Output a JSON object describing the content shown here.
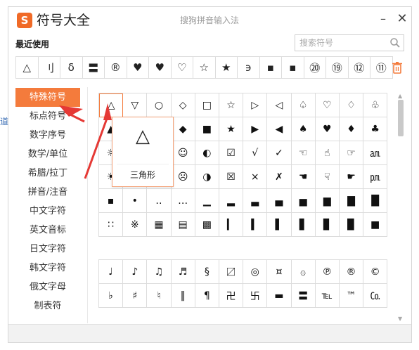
{
  "window": {
    "title": "符号大全",
    "subtitle": "搜狗拼音输入法",
    "logo_letter": "S",
    "minimize_icon": "–",
    "close_icon": "✕",
    "left_hint": "道"
  },
  "recent": {
    "label": "最近使用",
    "symbols": [
      "△",
      "刂",
      "δ",
      "〓",
      "®",
      "♥",
      "♥",
      "♡",
      "☆",
      "★",
      "϶",
      "▪",
      "▪",
      "⑳",
      "⑲",
      "⑫",
      "⑪"
    ]
  },
  "search": {
    "placeholder": "搜索符号",
    "value": ""
  },
  "sidebar": {
    "items": [
      {
        "label": "特殊符号",
        "active": true
      },
      {
        "label": "标点符号",
        "active": false
      },
      {
        "label": "数字序号",
        "active": false
      },
      {
        "label": "数学/单位",
        "active": false
      },
      {
        "label": "希腊/拉丁",
        "active": false
      },
      {
        "label": "拼音/注音",
        "active": false
      },
      {
        "label": "中文字符",
        "active": false
      },
      {
        "label": "英文音标",
        "active": false
      },
      {
        "label": "日文字符",
        "active": false
      },
      {
        "label": "韩文字符",
        "active": false
      },
      {
        "label": "俄文字母",
        "active": false
      },
      {
        "label": "制表符",
        "active": false
      }
    ]
  },
  "grid_top": {
    "symbols": [
      "△",
      "▽",
      "○",
      "◇",
      "□",
      "☆",
      "▷",
      "◁",
      "♤",
      "♡",
      "♢",
      "♧",
      "▲",
      "▼",
      "●",
      "◆",
      "■",
      "★",
      "▶",
      "◀",
      "♠",
      "♥",
      "♦",
      "♣",
      "☼",
      "☽",
      "☾",
      "☺",
      "◐",
      "☑",
      "√",
      "✓",
      "☜",
      "☝",
      "☞",
      "㏂",
      "☀",
      "☁",
      "☂",
      "☹",
      "◑",
      "☒",
      "×",
      "✗",
      "☚",
      "☟",
      "☛",
      "㏘",
      "▪",
      "•",
      "‥",
      "…",
      "▁",
      "▂",
      "▃",
      "▄",
      "▅",
      "▆",
      "▇",
      "█",
      "∷",
      "※",
      "▦",
      "▤",
      "▩",
      "▎",
      "▍",
      "▌",
      "▋",
      "▊",
      "▉",
      "■"
    ]
  },
  "grid_bottom": {
    "symbols": [
      "♩",
      "♪",
      "♫",
      "♬",
      "§",
      "〼",
      "◎",
      "¤",
      "۞",
      "℗",
      "®",
      "©",
      "♭",
      "♯",
      "♮",
      "‖",
      "¶",
      "卍",
      "卐",
      "▬",
      "〓",
      "℡",
      "™",
      "㏇"
    ]
  },
  "preview": {
    "symbol": "△",
    "name": "三角形"
  },
  "scrollbar": {
    "up_icon": "▲",
    "down_icon": "▼"
  },
  "colors": {
    "accent": "#f47b3c",
    "annotation_arrow": "#e53935"
  }
}
